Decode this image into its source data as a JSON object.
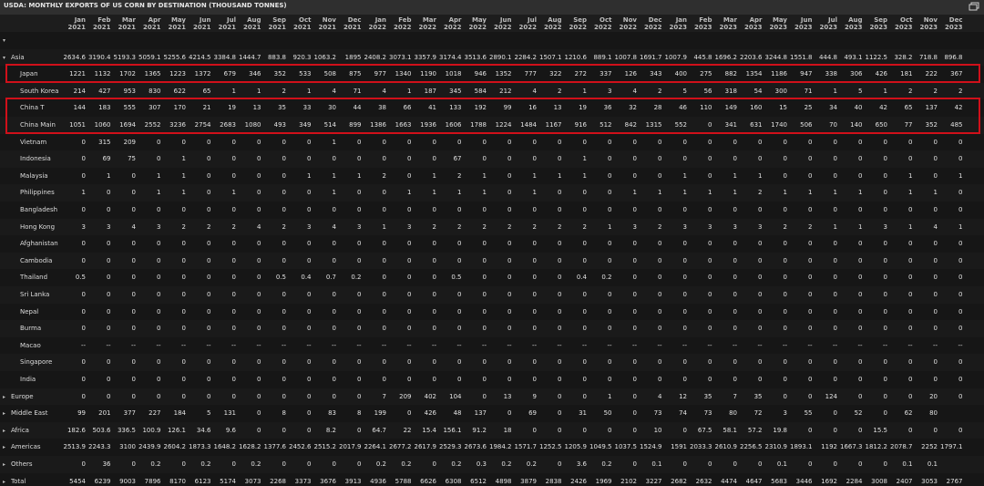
{
  "title": "USDA: MONTHLY EXPORTS OF US CORN BY DESTINATION (THOUSAND TONNES)",
  "window_icon": "restore-icon",
  "colors": {
    "highlight": "#d0101a",
    "background": "#161616",
    "header": "#2f2f2f"
  },
  "columns": [
    {
      "m": "Jan",
      "y": "2021"
    },
    {
      "m": "Feb",
      "y": "2021"
    },
    {
      "m": "Mar",
      "y": "2021"
    },
    {
      "m": "Apr",
      "y": "2021"
    },
    {
      "m": "May",
      "y": "2021"
    },
    {
      "m": "Jun",
      "y": "2021"
    },
    {
      "m": "Jul",
      "y": "2021"
    },
    {
      "m": "Aug",
      "y": "2021"
    },
    {
      "m": "Sep",
      "y": "2021"
    },
    {
      "m": "Oct",
      "y": "2021"
    },
    {
      "m": "Nov",
      "y": "2021"
    },
    {
      "m": "Dec",
      "y": "2021"
    },
    {
      "m": "Jan",
      "y": "2022"
    },
    {
      "m": "Feb",
      "y": "2022"
    },
    {
      "m": "Mar",
      "y": "2022"
    },
    {
      "m": "Apr",
      "y": "2022"
    },
    {
      "m": "May",
      "y": "2022"
    },
    {
      "m": "Jun",
      "y": "2022"
    },
    {
      "m": "Jul",
      "y": "2022"
    },
    {
      "m": "Aug",
      "y": "2022"
    },
    {
      "m": "Sep",
      "y": "2022"
    },
    {
      "m": "Oct",
      "y": "2022"
    },
    {
      "m": "Nov",
      "y": "2022"
    },
    {
      "m": "Dec",
      "y": "2022"
    },
    {
      "m": "Jan",
      "y": "2023"
    },
    {
      "m": "Feb",
      "y": "2023"
    },
    {
      "m": "Mar",
      "y": "2023"
    },
    {
      "m": "Apr",
      "y": "2023"
    },
    {
      "m": "May",
      "y": "2023"
    },
    {
      "m": "Jun",
      "y": "2023"
    },
    {
      "m": "Jul",
      "y": "2023"
    },
    {
      "m": "Aug",
      "y": "2023"
    },
    {
      "m": "Sep",
      "y": "2023"
    },
    {
      "m": "Oct",
      "y": "2023"
    },
    {
      "m": "Nov",
      "y": "2023"
    },
    {
      "m": "Dec",
      "y": "2023"
    }
  ],
  "rows": [
    {
      "label": "",
      "toggle": "down",
      "values": []
    },
    {
      "label": "Asia",
      "toggle": "down",
      "values": [
        "2634.6",
        "3190.4",
        "5193.3",
        "5059.1",
        "5255.6",
        "4214.5",
        "3384.8",
        "1444.7",
        "883.8",
        "920.3",
        "1063.2",
        "1895",
        "2408.2",
        "3073.1",
        "3357.9",
        "3174.4",
        "3513.6",
        "2890.1",
        "2284.2",
        "1507.1",
        "1210.6",
        "889.1",
        "1007.8",
        "1691.7",
        "1007.9",
        "445.8",
        "1696.2",
        "2203.6",
        "3244.8",
        "1551.8",
        "444.8",
        "493.1",
        "1122.5",
        "328.2",
        "718.8",
        "896.8"
      ]
    },
    {
      "label": "Japan",
      "indent": true,
      "highlight": true,
      "values": [
        "1221",
        "1132",
        "1702",
        "1365",
        "1223",
        "1372",
        "679",
        "346",
        "352",
        "533",
        "508",
        "875",
        "977",
        "1340",
        "1190",
        "1018",
        "946",
        "1352",
        "777",
        "322",
        "272",
        "337",
        "126",
        "343",
        "400",
        "275",
        "882",
        "1354",
        "1186",
        "947",
        "338",
        "306",
        "426",
        "181",
        "222",
        "367"
      ]
    },
    {
      "label": "South Korea",
      "indent": true,
      "values": [
        "214",
        "427",
        "953",
        "830",
        "622",
        "65",
        "1",
        "1",
        "2",
        "1",
        "4",
        "71",
        "4",
        "1",
        "187",
        "345",
        "584",
        "212",
        "4",
        "2",
        "1",
        "3",
        "4",
        "2",
        "5",
        "56",
        "318",
        "54",
        "300",
        "71",
        "1",
        "5",
        "1",
        "2",
        "2",
        "2"
      ]
    },
    {
      "label": "China T",
      "indent": true,
      "highlight": true,
      "values": [
        "144",
        "183",
        "555",
        "307",
        "170",
        "21",
        "19",
        "13",
        "35",
        "33",
        "30",
        "44",
        "38",
        "66",
        "41",
        "133",
        "192",
        "99",
        "16",
        "13",
        "19",
        "36",
        "32",
        "28",
        "46",
        "110",
        "149",
        "160",
        "15",
        "25",
        "34",
        "40",
        "42",
        "65",
        "137",
        "42"
      ]
    },
    {
      "label": "China Main",
      "indent": true,
      "highlight": true,
      "values": [
        "1051",
        "1060",
        "1694",
        "2552",
        "3236",
        "2754",
        "2683",
        "1080",
        "493",
        "349",
        "514",
        "899",
        "1386",
        "1663",
        "1936",
        "1606",
        "1788",
        "1224",
        "1484",
        "1167",
        "916",
        "512",
        "842",
        "1315",
        "552",
        "0",
        "341",
        "631",
        "1740",
        "506",
        "70",
        "140",
        "650",
        "77",
        "352",
        "485"
      ]
    },
    {
      "label": "Vietnam",
      "indent": true,
      "values": [
        "0",
        "315",
        "209",
        "0",
        "0",
        "0",
        "0",
        "0",
        "0",
        "0",
        "1",
        "0",
        "0",
        "0",
        "0",
        "0",
        "0",
        "0",
        "0",
        "0",
        "0",
        "0",
        "0",
        "0",
        "0",
        "0",
        "0",
        "0",
        "0",
        "0",
        "0",
        "0",
        "0",
        "0",
        "0",
        "0"
      ]
    },
    {
      "label": "Indonesia",
      "indent": true,
      "values": [
        "0",
        "69",
        "75",
        "0",
        "1",
        "0",
        "0",
        "0",
        "0",
        "0",
        "0",
        "0",
        "0",
        "0",
        "0",
        "67",
        "0",
        "0",
        "0",
        "0",
        "1",
        "0",
        "0",
        "0",
        "0",
        "0",
        "0",
        "0",
        "0",
        "0",
        "0",
        "0",
        "0",
        "0",
        "0",
        "0"
      ]
    },
    {
      "label": "Malaysia",
      "indent": true,
      "values": [
        "0",
        "1",
        "0",
        "1",
        "1",
        "0",
        "0",
        "0",
        "0",
        "1",
        "1",
        "1",
        "2",
        "0",
        "1",
        "2",
        "1",
        "0",
        "1",
        "1",
        "1",
        "0",
        "0",
        "0",
        "1",
        "0",
        "1",
        "1",
        "0",
        "0",
        "0",
        "0",
        "0",
        "1",
        "0",
        "1"
      ]
    },
    {
      "label": "Philippines",
      "indent": true,
      "values": [
        "1",
        "0",
        "0",
        "1",
        "1",
        "0",
        "1",
        "0",
        "0",
        "0",
        "1",
        "0",
        "0",
        "1",
        "1",
        "1",
        "1",
        "0",
        "1",
        "0",
        "0",
        "0",
        "1",
        "1",
        "1",
        "1",
        "1",
        "2",
        "1",
        "1",
        "1",
        "1",
        "0",
        "1",
        "1",
        "0"
      ]
    },
    {
      "label": "Bangladesh",
      "indent": true,
      "values": [
        "0",
        "0",
        "0",
        "0",
        "0",
        "0",
        "0",
        "0",
        "0",
        "0",
        "0",
        "0",
        "0",
        "0",
        "0",
        "0",
        "0",
        "0",
        "0",
        "0",
        "0",
        "0",
        "0",
        "0",
        "0",
        "0",
        "0",
        "0",
        "0",
        "0",
        "0",
        "0",
        "0",
        "0",
        "0",
        "0"
      ]
    },
    {
      "label": "Hong Kong",
      "indent": true,
      "values": [
        "3",
        "3",
        "4",
        "3",
        "2",
        "2",
        "2",
        "4",
        "2",
        "3",
        "4",
        "3",
        "1",
        "3",
        "2",
        "2",
        "2",
        "2",
        "2",
        "2",
        "2",
        "1",
        "3",
        "2",
        "3",
        "3",
        "3",
        "3",
        "2",
        "2",
        "1",
        "1",
        "3",
        "1",
        "4",
        "1"
      ]
    },
    {
      "label": "Afghanistan",
      "indent": true,
      "values": [
        "0",
        "0",
        "0",
        "0",
        "0",
        "0",
        "0",
        "0",
        "0",
        "0",
        "0",
        "0",
        "0",
        "0",
        "0",
        "0",
        "0",
        "0",
        "0",
        "0",
        "0",
        "0",
        "0",
        "0",
        "0",
        "0",
        "0",
        "0",
        "0",
        "0",
        "0",
        "0",
        "0",
        "0",
        "0",
        "0"
      ]
    },
    {
      "label": "Cambodia",
      "indent": true,
      "values": [
        "0",
        "0",
        "0",
        "0",
        "0",
        "0",
        "0",
        "0",
        "0",
        "0",
        "0",
        "0",
        "0",
        "0",
        "0",
        "0",
        "0",
        "0",
        "0",
        "0",
        "0",
        "0",
        "0",
        "0",
        "0",
        "0",
        "0",
        "0",
        "0",
        "0",
        "0",
        "0",
        "0",
        "0",
        "0",
        "0"
      ]
    },
    {
      "label": "Thailand",
      "indent": true,
      "values": [
        "0.5",
        "0",
        "0",
        "0",
        "0",
        "0",
        "0",
        "0",
        "0.5",
        "0.4",
        "0.7",
        "0.2",
        "0",
        "0",
        "0",
        "0.5",
        "0",
        "0",
        "0",
        "0",
        "0.4",
        "0.2",
        "0",
        "0",
        "0",
        "0",
        "0",
        "0",
        "0",
        "0",
        "0",
        "0",
        "0",
        "0",
        "0",
        "0"
      ]
    },
    {
      "label": "Sri Lanka",
      "indent": true,
      "values": [
        "0",
        "0",
        "0",
        "0",
        "0",
        "0",
        "0",
        "0",
        "0",
        "0",
        "0",
        "0",
        "0",
        "0",
        "0",
        "0",
        "0",
        "0",
        "0",
        "0",
        "0",
        "0",
        "0",
        "0",
        "0",
        "0",
        "0",
        "0",
        "0",
        "0",
        "0",
        "0",
        "0",
        "0",
        "0",
        "0"
      ]
    },
    {
      "label": "Nepal",
      "indent": true,
      "values": [
        "0",
        "0",
        "0",
        "0",
        "0",
        "0",
        "0",
        "0",
        "0",
        "0",
        "0",
        "0",
        "0",
        "0",
        "0",
        "0",
        "0",
        "0",
        "0",
        "0",
        "0",
        "0",
        "0",
        "0",
        "0",
        "0",
        "0",
        "0",
        "0",
        "0",
        "0",
        "0",
        "0",
        "0",
        "0",
        "0"
      ]
    },
    {
      "label": "Burma",
      "indent": true,
      "values": [
        "0",
        "0",
        "0",
        "0",
        "0",
        "0",
        "0",
        "0",
        "0",
        "0",
        "0",
        "0",
        "0",
        "0",
        "0",
        "0",
        "0",
        "0",
        "0",
        "0",
        "0",
        "0",
        "0",
        "0",
        "0",
        "0",
        "0",
        "0",
        "0",
        "0",
        "0",
        "0",
        "0",
        "0",
        "0",
        "0"
      ]
    },
    {
      "label": "Macao",
      "indent": true,
      "values": [
        "--",
        "--",
        "--",
        "--",
        "--",
        "--",
        "--",
        "--",
        "--",
        "--",
        "--",
        "--",
        "--",
        "--",
        "--",
        "--",
        "--",
        "--",
        "--",
        "--",
        "--",
        "--",
        "--",
        "--",
        "--",
        "--",
        "--",
        "--",
        "--",
        "--",
        "--",
        "--",
        "--",
        "--",
        "--",
        "--"
      ]
    },
    {
      "label": "Singapore",
      "indent": true,
      "values": [
        "0",
        "0",
        "0",
        "0",
        "0",
        "0",
        "0",
        "0",
        "0",
        "0",
        "0",
        "0",
        "0",
        "0",
        "0",
        "0",
        "0",
        "0",
        "0",
        "0",
        "0",
        "0",
        "0",
        "0",
        "0",
        "0",
        "0",
        "0",
        "0",
        "0",
        "0",
        "0",
        "0",
        "0",
        "0",
        "0"
      ]
    },
    {
      "label": "India",
      "indent": true,
      "values": [
        "0",
        "0",
        "0",
        "0",
        "0",
        "0",
        "0",
        "0",
        "0",
        "0",
        "0",
        "0",
        "0",
        "0",
        "0",
        "0",
        "0",
        "0",
        "0",
        "0",
        "0",
        "0",
        "0",
        "0",
        "0",
        "0",
        "0",
        "0",
        "0",
        "0",
        "0",
        "0",
        "0",
        "0",
        "0",
        "0"
      ]
    },
    {
      "label": "Europe",
      "toggle": "right",
      "values": [
        "0",
        "0",
        "0",
        "0",
        "0",
        "0",
        "0",
        "0",
        "0",
        "0",
        "0",
        "0",
        "7",
        "209",
        "402",
        "104",
        "0",
        "13",
        "9",
        "0",
        "0",
        "1",
        "0",
        "4",
        "12",
        "35",
        "7",
        "35",
        "0",
        "0",
        "124",
        "0",
        "0",
        "0",
        "20",
        "0"
      ]
    },
    {
      "label": "Middle East",
      "toggle": "right",
      "values": [
        "99",
        "201",
        "377",
        "227",
        "184",
        "5",
        "131",
        "0",
        "8",
        "0",
        "83",
        "8",
        "199",
        "0",
        "426",
        "48",
        "137",
        "0",
        "69",
        "0",
        "31",
        "50",
        "0",
        "73",
        "74",
        "73",
        "80",
        "72",
        "3",
        "55",
        "0",
        "52",
        "0",
        "62",
        "80",
        ""
      ]
    },
    {
      "label": "Africa",
      "toggle": "right",
      "values": [
        "182.6",
        "503.6",
        "336.5",
        "100.9",
        "126.1",
        "34.6",
        "9.6",
        "0",
        "0",
        "0",
        "8.2",
        "0",
        "64.7",
        "22",
        "15.4",
        "156.1",
        "91.2",
        "18",
        "0",
        "0",
        "0",
        "0",
        "0",
        "10",
        "0",
        "67.5",
        "58.1",
        "57.2",
        "19.8",
        "0",
        "0",
        "0",
        "15.5",
        "0",
        "0",
        "0"
      ]
    },
    {
      "label": "Americas",
      "toggle": "right",
      "values": [
        "2513.9",
        "2243.3",
        "3100",
        "2439.9",
        "2604.2",
        "1873.3",
        "1648.2",
        "1628.2",
        "1377.6",
        "2452.6",
        "2515.2",
        "2017.9",
        "2264.1",
        "2677.2",
        "2617.9",
        "2529.3",
        "2673.6",
        "1984.2",
        "1571.7",
        "1252.5",
        "1205.9",
        "1049.5",
        "1037.5",
        "1524.9",
        "1591",
        "2033.3",
        "2610.9",
        "2256.5",
        "2310.9",
        "1893.1",
        "1192",
        "1667.3",
        "1812.2",
        "2078.7",
        "2252",
        "1797.1"
      ]
    },
    {
      "label": "Others",
      "toggle": "right",
      "values": [
        "0",
        "36",
        "0",
        "0.2",
        "0",
        "0.2",
        "0",
        "0.2",
        "0",
        "0",
        "0",
        "0",
        "0.2",
        "0.2",
        "0",
        "0.2",
        "0.3",
        "0.2",
        "0.2",
        "0",
        "3.6",
        "0.2",
        "0",
        "0.1",
        "0",
        "0",
        "0",
        "0",
        "0.1",
        "0",
        "0",
        "0",
        "0",
        "0.1",
        "0.1",
        ""
      ]
    },
    {
      "label": "Total",
      "toggle": "right",
      "values": [
        "5454",
        "6239",
        "9003",
        "7896",
        "8170",
        "6123",
        "5174",
        "3073",
        "2268",
        "3373",
        "3676",
        "3913",
        "4936",
        "5788",
        "6626",
        "6308",
        "6512",
        "4898",
        "3879",
        "2838",
        "2426",
        "1969",
        "2102",
        "3227",
        "2682",
        "2632",
        "4474",
        "4647",
        "5683",
        "3446",
        "1692",
        "2284",
        "3008",
        "2407",
        "3053",
        "2767"
      ]
    }
  ]
}
